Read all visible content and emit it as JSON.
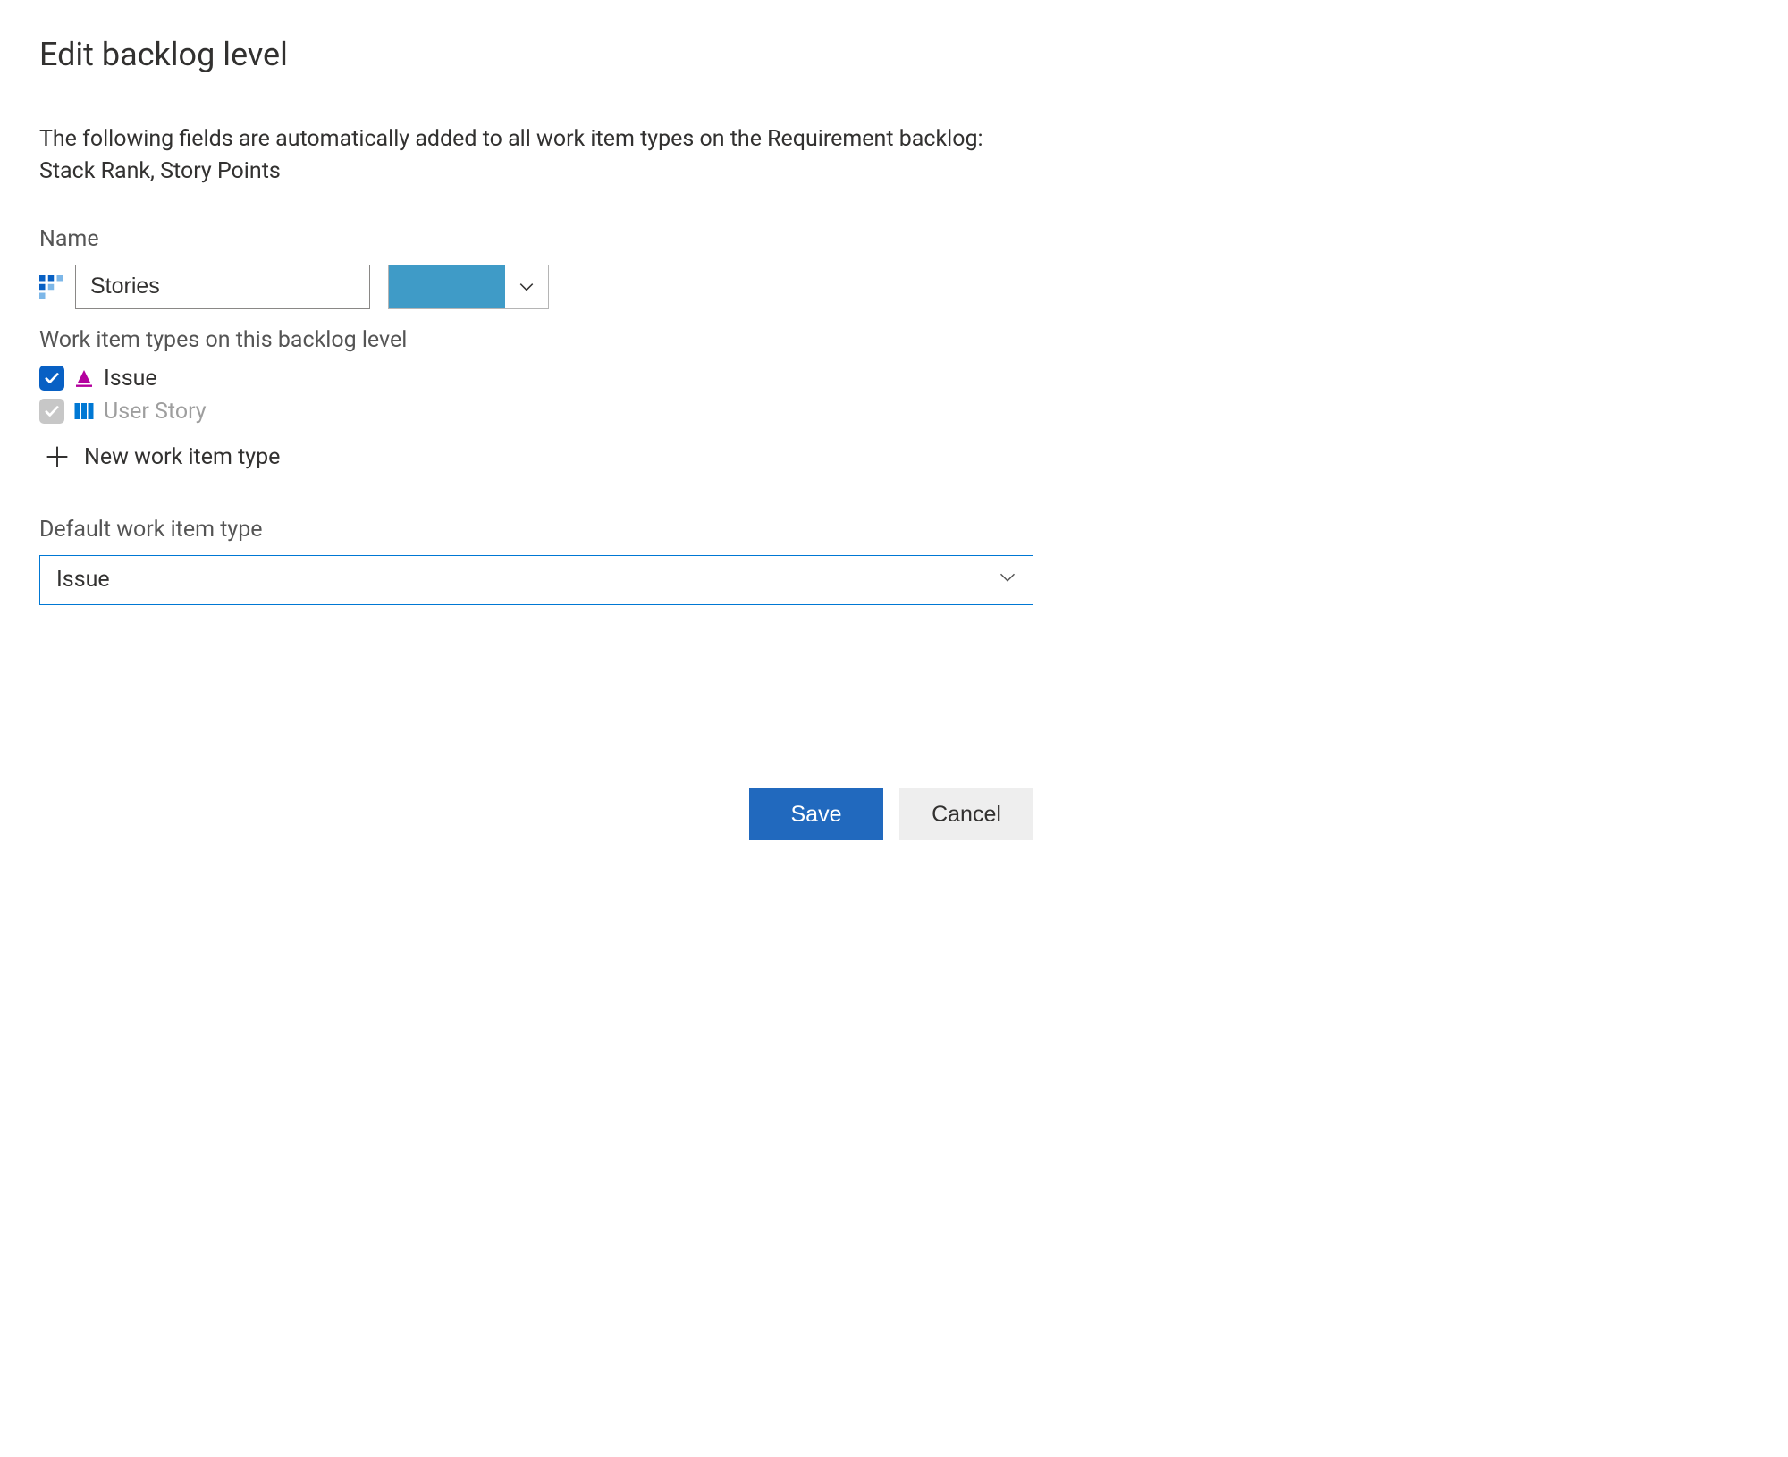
{
  "dialog": {
    "title": "Edit backlog level",
    "description": "The following fields are automatically added to all work item types on the Requirement backlog: Stack Rank, Story Points"
  },
  "name": {
    "label": "Name",
    "value": "Stories",
    "color": "#3F9BC7"
  },
  "wit": {
    "label": "Work item types on this backlog level",
    "items": [
      {
        "label": "Issue",
        "checked": true,
        "enabled": true,
        "iconColor": "#B4009E"
      },
      {
        "label": "User Story",
        "checked": true,
        "enabled": false,
        "iconColor": "#0078d4"
      }
    ],
    "new_label": "New work item type"
  },
  "default_wit": {
    "label": "Default work item type",
    "value": "Issue"
  },
  "footer": {
    "save": "Save",
    "cancel": "Cancel"
  }
}
